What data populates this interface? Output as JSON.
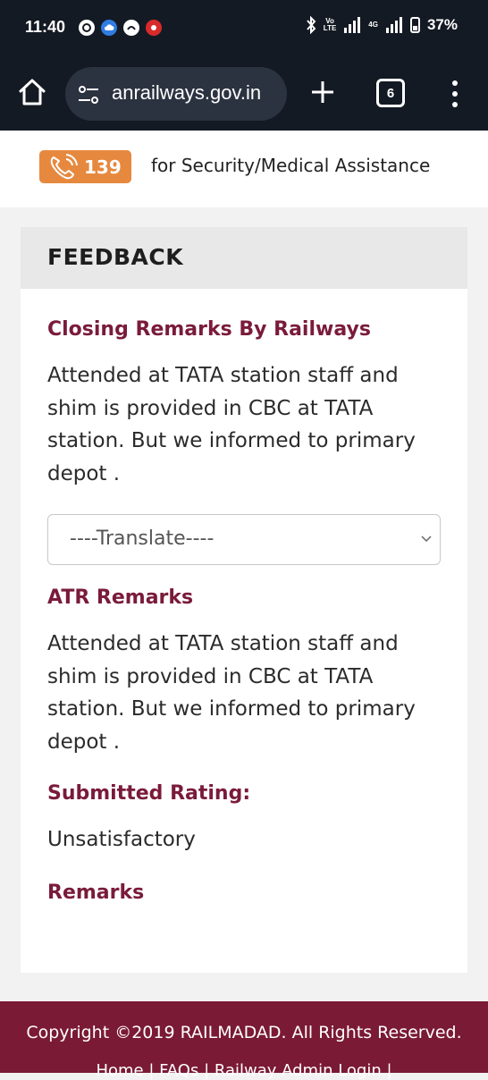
{
  "status_bar": {
    "time": "11:40",
    "network_volte": "Vo",
    "network_lte": "LTE",
    "network_4g": "4G",
    "battery": "37%"
  },
  "browser": {
    "url": "anrailways.gov.in",
    "tab_count": "6"
  },
  "helpline": {
    "number": "139",
    "text": "for Security/Medical Assistance",
    "badge_color": "#e6893f"
  },
  "feedback": {
    "title": "FEEDBACK",
    "closing_heading": "Closing Remarks By Railways",
    "closing_text": "Attended at TATA station staff and shim is provided in CBC at TATA station. But we informed to primary depot .",
    "translate_selected": "----Translate----",
    "atr_heading": "ATR Remarks",
    "atr_text": "Attended at TATA station staff and shim is provided in CBC at TATA station. But we informed to primary depot .",
    "rating_heading": "Submitted Rating:",
    "rating_value": "Unsatisfactory",
    "remarks_heading": "Remarks",
    "heading_color": "#7a1b3a"
  },
  "footer": {
    "copyright": "Copyright ©2019 RAILMADAD. All Rights Reserved.",
    "links": "Home  |  FAQs  |  Railway Admin Login  |",
    "color": "#7a1a34"
  }
}
